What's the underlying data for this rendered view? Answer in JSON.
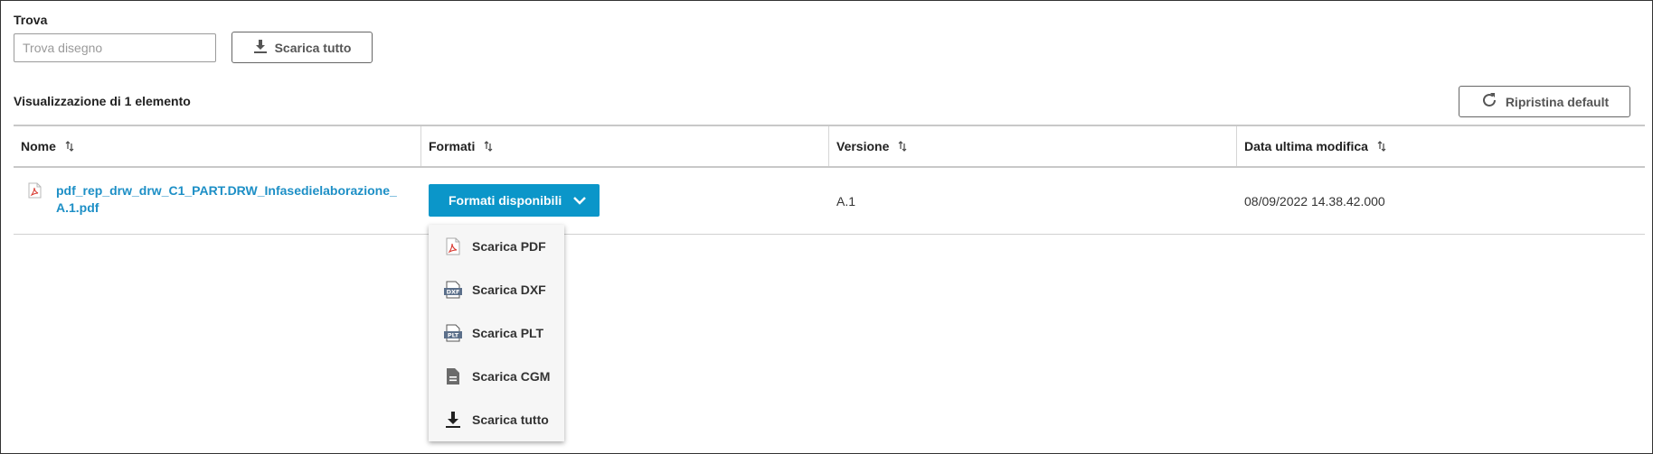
{
  "search": {
    "label": "Trova",
    "placeholder": "Trova disegno",
    "value": ""
  },
  "toolbar": {
    "download_all_label": "Scarica tutto",
    "reset_label": "Ripristina default",
    "count_label": "Visualizzazione di 1 elemento"
  },
  "table": {
    "headers": [
      "Nome",
      "Formati",
      "Versione",
      "Data ultima modifica"
    ],
    "rows": [
      {
        "name": "pdf_rep_drw_drw_C1_PART.DRW_Infasedielaborazione_A.1.pdf",
        "formats_button": "Formati disponibili",
        "version": "A.1",
        "modified": "08/09/2022 14.38.42.000"
      }
    ]
  },
  "formats_menu": {
    "items": [
      {
        "label": "Scarica PDF",
        "icon": "pdf-file-icon"
      },
      {
        "label": "Scarica DXF",
        "icon": "dxf-file-icon"
      },
      {
        "label": "Scarica PLT",
        "icon": "plt-file-icon"
      },
      {
        "label": "Scarica CGM",
        "icon": "document-icon"
      },
      {
        "label": "Scarica tutto",
        "icon": "download-icon"
      }
    ]
  },
  "colors": {
    "accent": "#0b96c9",
    "link": "#1d8fc6",
    "pdf_red": "#d9382f"
  }
}
